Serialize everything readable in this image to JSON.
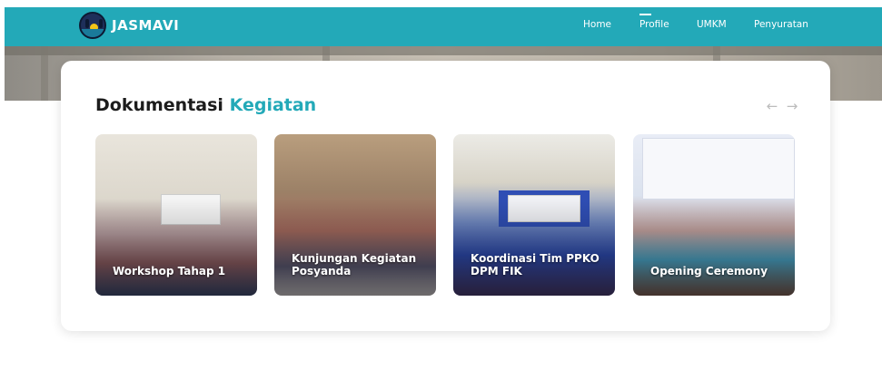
{
  "navbar": {
    "brand": "JASMAVI",
    "links": [
      {
        "label": "Home",
        "active": false
      },
      {
        "label": "Profile",
        "active": true
      },
      {
        "label": "UMKM",
        "active": false
      },
      {
        "label": "Penyuratan",
        "active": false
      }
    ]
  },
  "section": {
    "title_main": "Dokumentasi",
    "title_accent": "Kegiatan",
    "prev_icon": "arrow-left-icon",
    "next_icon": "arrow-right-icon"
  },
  "slides": [
    {
      "caption": "Workshop Tahap 1"
    },
    {
      "caption": "Kunjungan Kegiatan Posyanda"
    },
    {
      "caption": "Koordinasi Tim PPKO DPM FIK"
    },
    {
      "caption": "Opening Ceremony"
    }
  ],
  "colors": {
    "brand": "#23a9b8",
    "title": "#1c1c1c",
    "arrow": "#bcbcbc"
  }
}
